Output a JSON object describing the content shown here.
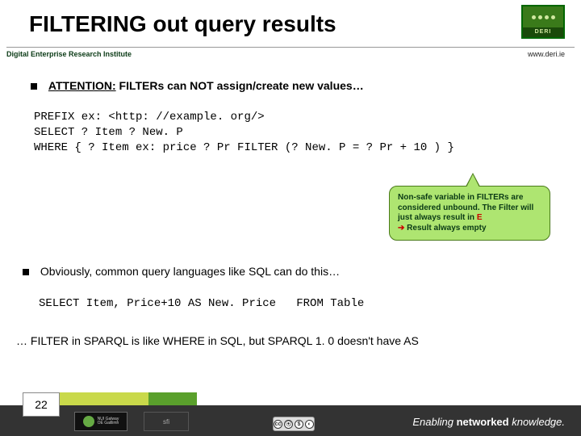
{
  "title": "FILTERING out query results",
  "header": {
    "institute": "Digital Enterprise Research Institute",
    "url": "www.deri.ie",
    "logo_label": "DERI"
  },
  "bullet1": {
    "attention": "ATTENTION:",
    "rest": " FILTERs can NOT assign/create new values…"
  },
  "code1": "PREFIX ex: <http: //example. org/>\nSELECT ? Item ? New. P\nWHERE { ? Item ex: price ? Pr FILTER (? New. P = ? Pr + 10 ) }",
  "callout": {
    "line1": "Non-safe variable in FILTERs are considered unbound. The Filter will just always result in ",
    "e": "E",
    "arrow": "➔",
    "line2": " Result always empty"
  },
  "bullet2": "Obviously, common query languages like SQL can do this…",
  "code2": "SELECT Item, Price+10 AS New. Price   FROM Table",
  "note": "… FILTER in SPARQL is like WHERE in SQL, but SPARQL 1. 0 doesn't have AS",
  "footer": {
    "page": "22",
    "tagline_pre": "Enabling ",
    "tagline_b": "networked",
    "tagline_post": " knowledge.",
    "license": "BY NC SA"
  }
}
